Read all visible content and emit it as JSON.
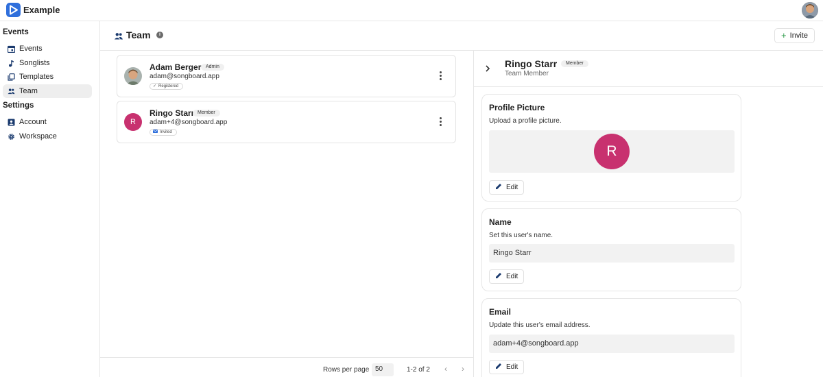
{
  "app": {
    "title": "Example"
  },
  "sidebar": {
    "sections": [
      {
        "label": "Events"
      },
      {
        "label": "Settings"
      }
    ],
    "items": [
      {
        "label": "Events",
        "icon": "calendar-icon"
      },
      {
        "label": "Songlists",
        "icon": "music-note-icon"
      },
      {
        "label": "Templates",
        "icon": "copy-icon"
      },
      {
        "label": "Team",
        "icon": "people-icon",
        "active": true
      },
      {
        "label": "Account",
        "icon": "account-box-icon"
      },
      {
        "label": "Workspace",
        "icon": "gear-icon"
      }
    ]
  },
  "header": {
    "title": "Team",
    "invite_label": "Invite",
    "info_icon": "info-icon"
  },
  "members": [
    {
      "name": "Adam Berger",
      "role": "Admin",
      "email": "adam@songboard.app",
      "status": "Registered",
      "status_icon": "check-icon",
      "avatar": "photo"
    },
    {
      "name": "Ringo Starr",
      "role": "Member",
      "email": "adam+4@songboard.app",
      "status": "Invited",
      "status_icon": "mail-icon",
      "avatar": "R"
    }
  ],
  "footer": {
    "rows_per_page_label": "Rows per page",
    "rows_per_page_value": "50",
    "range": "1-2 of 2"
  },
  "detail": {
    "name": "Ringo Starr",
    "role": "Member",
    "subtitle": "Team Member",
    "profile_picture": {
      "title": "Profile Picture",
      "description": "Upload a profile picture.",
      "avatar_letter": "R",
      "edit_label": "Edit"
    },
    "name_section": {
      "title": "Name",
      "description": "Set this user's name.",
      "value": "Ringo Starr",
      "edit_label": "Edit"
    },
    "email_section": {
      "title": "Email",
      "description": "Update this user's email address.",
      "value": "adam+4@songboard.app",
      "edit_label": "Edit"
    }
  },
  "colors": {
    "accent": "#2f6fdc",
    "avatar_pink": "#c8316f",
    "invite_plus": "#2e9b4a"
  }
}
